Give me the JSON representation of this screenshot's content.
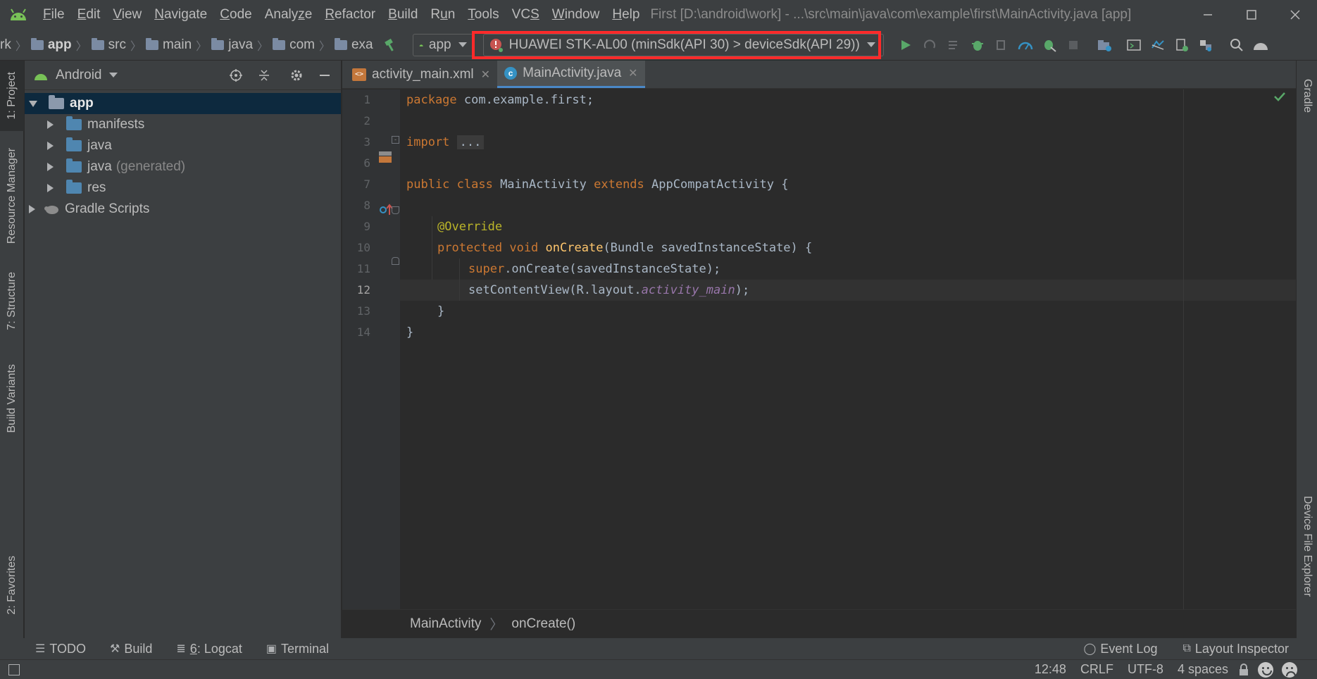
{
  "menubar": {
    "items": [
      {
        "label_pre": "",
        "mnemonic": "F",
        "label_post": "ile"
      },
      {
        "label_pre": "",
        "mnemonic": "E",
        "label_post": "dit"
      },
      {
        "label_pre": "",
        "mnemonic": "V",
        "label_post": "iew"
      },
      {
        "label_pre": "",
        "mnemonic": "N",
        "label_post": "avigate"
      },
      {
        "label_pre": "",
        "mnemonic": "C",
        "label_post": "ode"
      },
      {
        "label_pre": "Analy",
        "mnemonic": "z",
        "label_post": "e"
      },
      {
        "label_pre": "",
        "mnemonic": "R",
        "label_post": "efactor"
      },
      {
        "label_pre": "",
        "mnemonic": "B",
        "label_post": "uild"
      },
      {
        "label_pre": "R",
        "mnemonic": "u",
        "label_post": "n"
      },
      {
        "label_pre": "",
        "mnemonic": "T",
        "label_post": "ools"
      },
      {
        "label_pre": "VC",
        "mnemonic": "S",
        "label_post": ""
      },
      {
        "label_pre": "",
        "mnemonic": "W",
        "label_post": "indow"
      },
      {
        "label_pre": "",
        "mnemonic": "H",
        "label_post": "elp"
      }
    ],
    "window_title": "First [D:\\android\\work] - ...\\src\\main\\java\\com\\example\\first\\MainActivity.java [app]"
  },
  "navbar": {
    "crumbs": [
      "rk",
      "app",
      "src",
      "main",
      "java",
      "com",
      "exa"
    ],
    "run_config": "app",
    "device": "HUAWEI STK-AL00 (minSdk(API 30) > deviceSdk(API 29))"
  },
  "project_panel": {
    "view_mode": "Android",
    "tree": {
      "app": "app",
      "manifests": "manifests",
      "java": "java",
      "java_generated": "java",
      "generated_suffix": "(generated)",
      "res": "res",
      "gradle_scripts": "Gradle Scripts"
    }
  },
  "left_tabs": {
    "project": "1: Project",
    "resource_manager": "Resource Manager",
    "structure": "7: Structure",
    "build_variants": "Build Variants",
    "favorites": "2: Favorites"
  },
  "right_tabs": {
    "gradle": "Gradle",
    "device_file_explorer": "Device File Explorer"
  },
  "editor": {
    "tabs": [
      "activity_main.xml",
      "MainActivity.java"
    ],
    "line_numbers": [
      "1",
      "2",
      "3",
      "6",
      "7",
      "8",
      "9",
      "10",
      "11",
      "12",
      "13",
      "14"
    ],
    "current_line": "12",
    "code": {
      "l1_kw": "package",
      "l1_rest": " com.example.first;",
      "l3_kw": "import",
      "l3_fold": "...",
      "l7_kw1": "public class",
      "l7_name": " MainActivity ",
      "l7_kw2": "extends",
      "l7_rest": " AppCompatActivity {",
      "l9_ann": "@Override",
      "l10_kw": "protected void",
      "l10_fn": "onCreate",
      "l10_rest": "(Bundle savedInstanceState) {",
      "l11_kw": "super",
      "l11_rest": ".onCreate(savedInstanceState);",
      "l12_pre": "setContentView(R.layout.",
      "l12_it": "activity_main",
      "l12_post": ");",
      "l13": "}",
      "l14": "}"
    },
    "breadcrumbs": [
      "MainActivity",
      "onCreate()"
    ]
  },
  "bottom_tools": {
    "todo": "TODO",
    "build": "Build",
    "logcat_mn": "6",
    "logcat": ": Logcat",
    "terminal": "Terminal",
    "event_log": "Event Log",
    "layout_inspector": "Layout Inspector"
  },
  "statusbar": {
    "position": "12:48",
    "line_sep": "CRLF",
    "encoding": "UTF-8",
    "indent": "4 spaces"
  },
  "colors": {
    "accent": "#4a88c7",
    "highlight_box": "#ff2a2a",
    "run_green": "#59a869",
    "android_green": "#78c257"
  }
}
